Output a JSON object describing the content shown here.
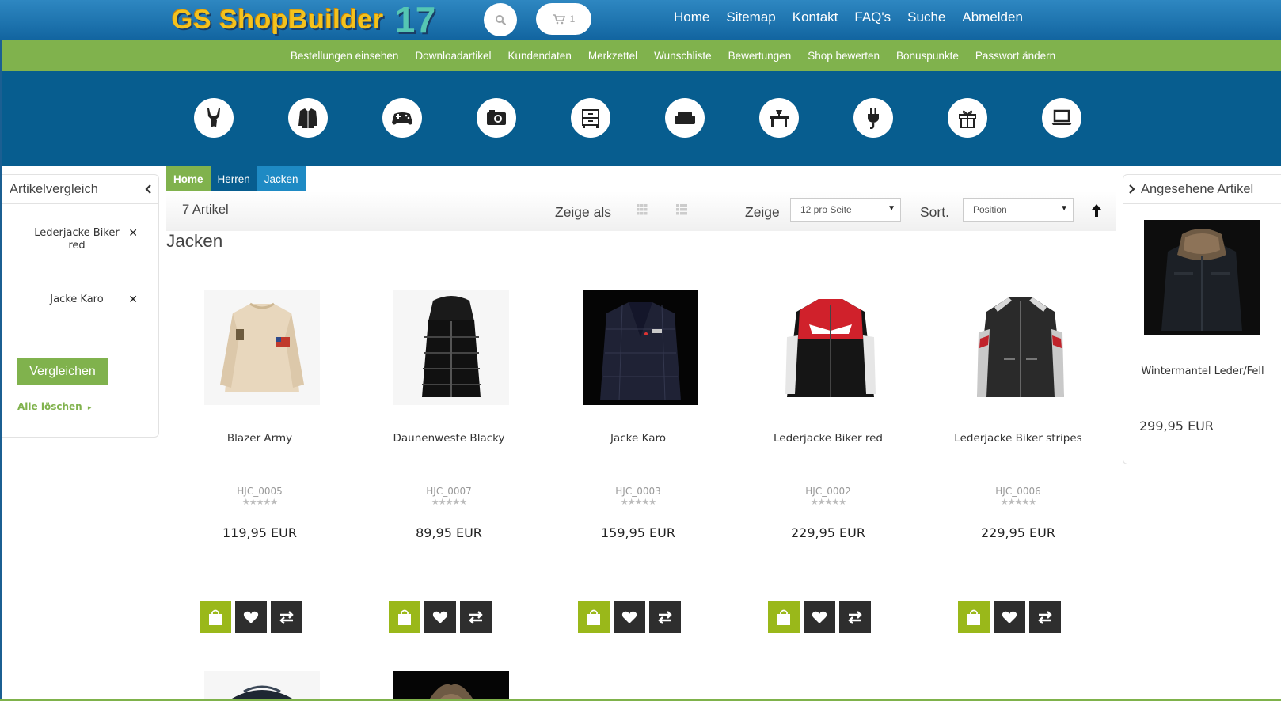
{
  "header": {
    "logo_text": "GS ShopBuilder",
    "logo_number": "17",
    "cart_count": "1",
    "nav": [
      "Home",
      "Sitemap",
      "Kontakt",
      "FAQ's",
      "Suche",
      "Abmelden"
    ]
  },
  "account_nav": [
    "Bestellungen einsehen",
    "Downloadartikel",
    "Kundendaten",
    "Merkzettel",
    "Wunschliste",
    "Bewertungen",
    "Shop bewerten",
    "Bonuspunkte",
    "Passwort ändern"
  ],
  "categories": [
    "underwear-icon",
    "jacket-icon",
    "gamepad-icon",
    "camera-icon",
    "drawer-icon",
    "sofa-icon",
    "table-icon",
    "plug-icon",
    "gift-icon",
    "laptop-icon"
  ],
  "compare": {
    "title": "Artikelvergleich",
    "items": [
      "Lederjacke Biker red",
      "Jacke Karo"
    ],
    "button": "Vergleichen",
    "clear": "Alle löschen"
  },
  "viewed": {
    "title": "Angesehene Artikel",
    "name": "Wintermantel Leder/Fell",
    "price": "299,95 EUR"
  },
  "breadcrumb": [
    "Home",
    "Herren",
    "Jacken"
  ],
  "toolbar": {
    "count": "7 Artikel",
    "view_label": "Zeige als",
    "show_label": "Zeige",
    "per_page": "12 pro Seite",
    "sort_label": "Sort.",
    "sort_value": "Position"
  },
  "page_title": "Jacken",
  "products": [
    {
      "name": "Blazer Army",
      "sku": "HJC_0005",
      "price": "119,95 EUR"
    },
    {
      "name": "Daunenweste Blacky",
      "sku": "HJC_0007",
      "price": "89,95 EUR"
    },
    {
      "name": "Jacke Karo",
      "sku": "HJC_0003",
      "price": "159,95 EUR"
    },
    {
      "name": "Lederjacke Biker red",
      "sku": "HJC_0002",
      "price": "229,95 EUR"
    },
    {
      "name": "Lederjacke Biker stripes",
      "sku": "HJC_0006",
      "price": "229,95 EUR"
    }
  ],
  "colors": {
    "header_blue": "#1b6ea8",
    "green": "#80b24d",
    "band_blue": "#075d8f",
    "cart_button": "#9ab81a"
  }
}
